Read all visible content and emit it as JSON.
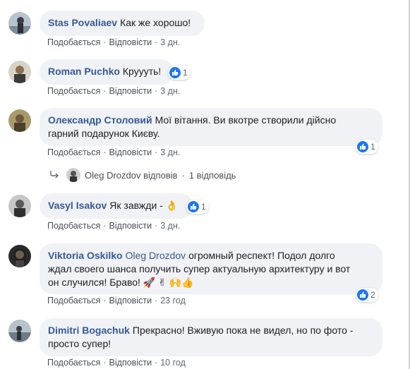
{
  "actions": {
    "like": "Подобається",
    "reply": "Відповісти",
    "dot": "·"
  },
  "comments": [
    {
      "author": "Stas Povaliaev",
      "text": "Как же хорошо!",
      "time": "3 дн."
    },
    {
      "author": "Roman Puchko",
      "text": "Круууть!",
      "time": "3 дн.",
      "reactions": "1"
    },
    {
      "author": "Олександр Столовий",
      "text_line1": "Мої вітання. Ви вкотре створили дійсно",
      "text_line2": "гарний подарунок Києву.",
      "time": "3 дн.",
      "reactions": "1"
    },
    {
      "author": "Vasyl Isakov",
      "text": "Як завжди -",
      "emoji": "👌",
      "time": "3 дн.",
      "reactions": "1"
    },
    {
      "author": "Viktoria Oskilko",
      "mention": "Oleg Drozdov",
      "text_line1": "огромный респект! Подол долго",
      "text_line2": "ждал своего шанса получить супер актуальную архитектуру и вот",
      "text_line3": "он случился! Браво!",
      "emoji": "🚀 ✌ 🙌👍",
      "time": "23 год",
      "reactions": "2"
    },
    {
      "author": "Dimitri Bogachuk",
      "text_line1": "Прекрасно! Вживую пока не видел, но по фото -",
      "text_line2": "просто супер!",
      "time": "10 год"
    }
  ],
  "reply_summary": {
    "author": "Oleg Drozdov",
    "verb": "відповів",
    "dot": "·",
    "count": "1 відповідь"
  },
  "colors": {
    "accent": "#385898",
    "bubble": "#f0f2f5",
    "like": "#1877f2"
  }
}
